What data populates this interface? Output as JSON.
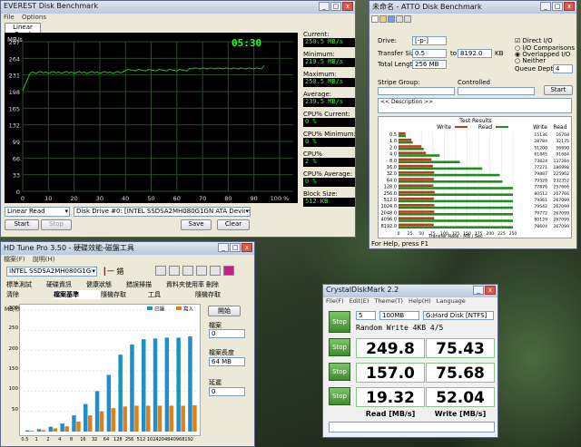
{
  "everest": {
    "title": "EVEREST Disk Benchmark",
    "menu": [
      "File",
      "Options"
    ],
    "tab": "Linear Read",
    "timer": "05:30",
    "y_unit": "MB/s",
    "y_ticks": [
      "297",
      "264",
      "231",
      "198",
      "165",
      "132",
      "99",
      "66",
      "33",
      "0"
    ],
    "x_ticks": [
      "0",
      "10",
      "20",
      "30",
      "40",
      "50",
      "60",
      "70",
      "80",
      "90",
      "100 %"
    ],
    "stats": [
      {
        "label": "Current:",
        "value": "250.5 MB/s"
      },
      {
        "label": "Minimum:",
        "value": "219.5 MB/s"
      },
      {
        "label": "Maximum:",
        "value": "250.5 MB/s"
      },
      {
        "label": "Average:",
        "value": "239.5 MB/s"
      },
      {
        "label": "CPU% Current:",
        "value": "0 %"
      },
      {
        "label": "CPU% Minimum:",
        "value": "0 %"
      },
      {
        "label": "CPU% Maximum:",
        "value": "2 %"
      },
      {
        "label": "CPU% Average:",
        "value": "0 %"
      },
      {
        "label": "Block Size:",
        "value": "512 KB"
      }
    ],
    "test_select": "Linear Read",
    "drive_select": "Disk Drive #0: [INTEL SSDSA2MH080G1GN ATA Device]  (76318 MB)",
    "buttons": {
      "start": "Start",
      "stop": "Stop",
      "save": "Save",
      "clear": "Clear"
    },
    "colors": {
      "bg": "#000000",
      "grid": "#2a4a2a",
      "line": "#1ec81e",
      "timer": "#22ff22"
    }
  },
  "atto": {
    "title": "未命名 - ATTO Disk Benchmark",
    "drive_label": "Drive:",
    "drive_value": "[-p-]",
    "transfer_label": "Transfer Size:",
    "transfer_from": "0.5",
    "to_label": "to",
    "transfer_to": "8192.0",
    "kb_label": "KB",
    "length_label": "Total Length:",
    "length_value": "256 MB",
    "direct_io": "Direct I/O",
    "io_comparisons": "I/O Comparisons",
    "overlapped_io": "Overlapped I/O",
    "neither": "Neither",
    "queue_label": "Queue Depth:",
    "queue_value": "4",
    "stripe_label": "Stripe Group:",
    "controlled_label": "Controlled",
    "start_button": "Start",
    "description": "<< Description >>",
    "results_title": "Test Results",
    "write_legend": "Write",
    "read_legend": "Read",
    "write_col": "Write",
    "read_col": "Read",
    "x_axis": "Transfer Rate - MB / Sec",
    "x_ticks": [
      "0",
      "25",
      "50",
      "75",
      "100",
      "125",
      "150",
      "175",
      "200",
      "225",
      "250"
    ],
    "status": "For Help, press F1",
    "colors": {
      "write": "#c0391b",
      "read": "#1f8c1f"
    }
  },
  "chart_data": {
    "type": "bar",
    "title": "Test Results",
    "xlabel": "Transfer Rate - MB / Sec",
    "xlim": [
      0,
      250
    ],
    "categories": [
      "0.5",
      "1.0",
      "2.0",
      "4.0",
      "8.0",
      "16.0",
      "32.0",
      "64.0",
      "128.0",
      "256.0",
      "512.0",
      "1024.0",
      "2048.0",
      "4096.0",
      "8192.0"
    ],
    "series": [
      {
        "name": "Write",
        "values": [
          15136,
          28784,
          51200,
          61845,
          73824,
          77271,
          79887,
          79328,
          77876,
          80512,
          79361,
          79542,
          79772,
          80129,
          78604
        ],
        "bar_mb": [
          15,
          28,
          50,
          60,
          72,
          75,
          78,
          77,
          76,
          79,
          77,
          78,
          78,
          78,
          77
        ]
      },
      {
        "name": "Read",
        "values": [
          16768,
          32175,
          56690,
          91684,
          137284,
          186998,
          225902,
          232352,
          257666,
          267766,
          267099,
          267099,
          267099,
          267099,
          267099
        ],
        "bar_mb": [
          16,
          31,
          55,
          90,
          134,
          183,
          221,
          227,
          252,
          261,
          261,
          261,
          261,
          261,
          261
        ]
      }
    ]
  },
  "hdtune": {
    "title": "HD Tune Pro 3.50 - 硬碟效能-磁盤工具",
    "menu": [
      "檔案(F)",
      "說明(H)"
    ],
    "drive": "INTEL SSDSA2MH080G1GN (80 GB)",
    "temp": "一 錯",
    "tabs_row1": [
      "標準測試",
      "硬碟資訊",
      "健康狀態",
      "錯誤掃描",
      "資料夾使用率",
      "刪除"
    ],
    "tabs_row2": [
      "清除",
      "檔案基準",
      "隨機存取",
      "工具",
      "隨機存取"
    ],
    "y_unit": "MB/秒",
    "legend_read": "已讀",
    "legend_write": "寫入",
    "y_ticks": [
      "300",
      "250",
      "200",
      "150",
      "100",
      "50"
    ],
    "x_ticks": [
      "0.5",
      "1",
      "2",
      "4",
      "8",
      "16",
      "32",
      "64",
      "128",
      "256",
      "512",
      "1024",
      "2048",
      "4096",
      "8192"
    ],
    "start_button": "開始",
    "group1_label": "檔案",
    "group1_value": "0",
    "group2_label": "檔案長度",
    "group2_value": "64 MB",
    "group3_label": "延遲",
    "group3_value": "0",
    "bars_read": [
      3,
      6,
      12,
      20,
      40,
      68,
      100,
      140,
      190,
      215,
      228,
      230,
      232,
      232,
      235
    ],
    "bars_write": [
      2,
      4,
      8,
      13,
      25,
      40,
      50,
      58,
      62,
      64,
      64,
      64,
      64,
      64,
      65
    ],
    "colors": {
      "read": "#1e8fcd",
      "write": "#e07f1a"
    }
  },
  "crystal": {
    "title": "CrystalDiskMark 2.2",
    "menu": [
      "File(F)",
      "Edit(E)",
      "Theme(T)",
      "Help(H)",
      "Language"
    ],
    "count": "5",
    "size": "100MB",
    "drive": "G:Hard Disk [NTFS]",
    "test_name": "Random Write 4KB 4/5",
    "stop_label": "Stop",
    "rows": [
      {
        "read": "249.8",
        "write": "75.43"
      },
      {
        "read": "157.0",
        "write": "75.68"
      },
      {
        "read": "19.32",
        "write": "52.04"
      }
    ],
    "read_label": "Read [MB/s]",
    "write_label": "Write [MB/s]"
  }
}
